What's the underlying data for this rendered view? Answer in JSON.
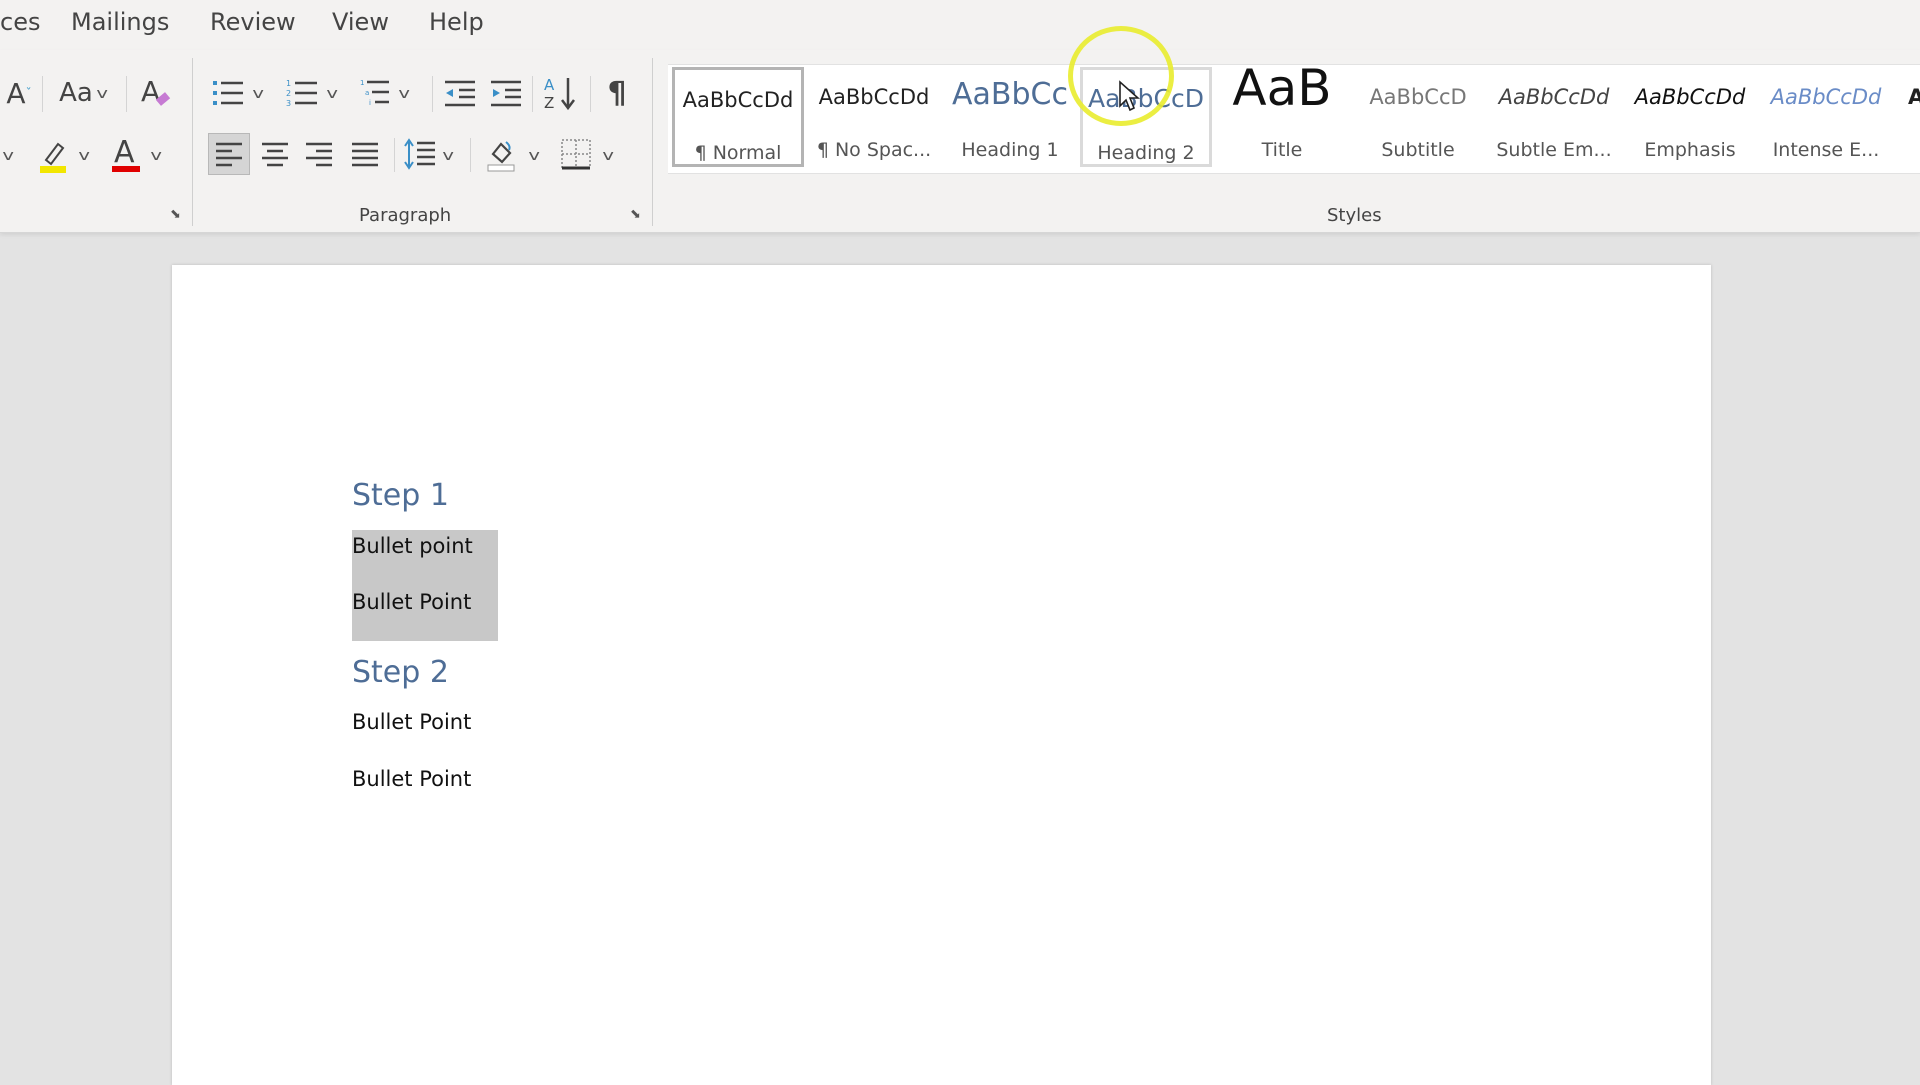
{
  "ribbon_tabs": [
    "ces",
    "Mailings",
    "Review",
    "View",
    "Help"
  ],
  "font_group": {
    "grow_font_icon": "font-size-decrease-icon",
    "change_case_label": "Aa",
    "clear_formatting_icon": "clear-formatting-icon",
    "highlight_color": "#f2e600",
    "font_color": "#e00000",
    "font_color_glyph": "A"
  },
  "paragraph_group": {
    "label": "Paragraph",
    "pilcrow": "¶",
    "sort_label": "AZ"
  },
  "styles_group": {
    "label": "Styles",
    "items": [
      {
        "sample": "AaBbCcDd",
        "label": "¶ Normal",
        "selected": true,
        "color": "#222222"
      },
      {
        "sample": "AaBbCcDd",
        "label": "¶ No Spac...",
        "selected": false,
        "color": "#222222"
      },
      {
        "sample": "AaBbCc",
        "label": "Heading 1",
        "selected": false,
        "color": "#4e6d96"
      },
      {
        "sample": "AaBbCcD",
        "label": "Heading 2",
        "selected": false,
        "hovered": true,
        "color": "#4e6d96"
      },
      {
        "sample": "AaB",
        "label": "Title",
        "selected": false,
        "color": "#111111"
      },
      {
        "sample": "AaBbCcD",
        "label": "Subtitle",
        "selected": false,
        "color": "#777777"
      },
      {
        "sample": "AaBbCcDd",
        "label": "Subtle Em...",
        "selected": false,
        "color": "#444444"
      },
      {
        "sample": "AaBbCcDd",
        "label": "Emphasis",
        "selected": false,
        "color": "#111111"
      },
      {
        "sample": "AaBbCcDd",
        "label": "Intense E...",
        "selected": false,
        "color": "#6a8cc7"
      },
      {
        "sample": "A",
        "label": "",
        "selected": false,
        "color": "#111111"
      }
    ]
  },
  "document": {
    "blocks": [
      {
        "type": "heading2",
        "text": "Step 1"
      },
      {
        "type": "body",
        "text": "Bullet point",
        "selected": true
      },
      {
        "type": "body",
        "text": "Bullet Point",
        "selected": true
      },
      {
        "type": "heading2",
        "text": "Step 2"
      },
      {
        "type": "body",
        "text": "Bullet Point"
      },
      {
        "type": "body",
        "text": "Bullet Point"
      }
    ]
  },
  "colors": {
    "heading": "#4e6d96",
    "selection": "#c8c8c8",
    "cursor_highlight": "#e9ec2e"
  }
}
